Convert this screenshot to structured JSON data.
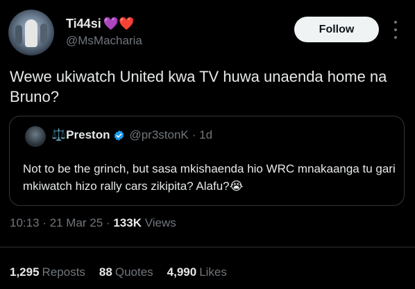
{
  "author": {
    "display_name": "Ti44si",
    "name_emojis": "💜❤️",
    "handle": "@MsMacharia"
  },
  "follow_label": "Follow",
  "tweet_text": "Wewe ukiwatch United kwa TV huwa unaenda home na Bruno?",
  "quote": {
    "name_prefix": "⚖️",
    "name": "Preston",
    "handle": "@pr3stonK",
    "time": "· 1d",
    "text": "Not to be the grinch, but sasa mkishaenda hio WRC mnakaanga tu gari mkiwatch hizo rally cars zikipita? Alafu?😭"
  },
  "meta": {
    "time": "10:13",
    "date": "21 Mar 25",
    "views_count": "133K",
    "views_label": "Views"
  },
  "stats": {
    "reposts_count": "1,295",
    "reposts_label": "Reposts",
    "quotes_count": "88",
    "quotes_label": "Quotes",
    "likes_count": "4,990",
    "likes_label": "Likes"
  },
  "colors": {
    "background": "#000000",
    "text": "#e7e9ea",
    "secondary": "#71767b",
    "verified": "#1d9bf0"
  }
}
